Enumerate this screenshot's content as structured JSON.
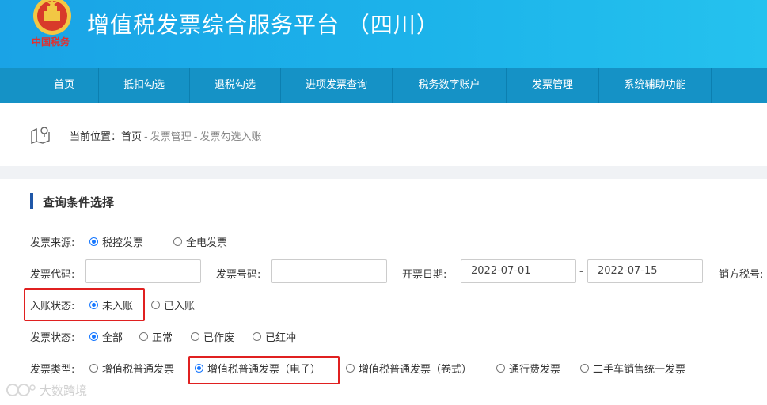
{
  "header": {
    "title": "增值税发票综合服务平台 （四川）",
    "brand": "中国税务"
  },
  "nav": {
    "items": [
      "首页",
      "抵扣勾选",
      "退税勾选",
      "进项发票查询",
      "税务数字账户",
      "发票管理",
      "系统辅助功能"
    ]
  },
  "breadcrumb": {
    "prefix": "当前位置：",
    "home": "首页",
    "sep": "-",
    "level1": "发票管理",
    "level2": "发票勾选入账"
  },
  "query": {
    "section_title": "查询条件选择",
    "source": {
      "label": "发票来源:",
      "options": [
        "税控发票",
        "全电发票"
      ],
      "selected": "税控发票"
    },
    "code": {
      "label": "发票代码:",
      "value": ""
    },
    "number": {
      "label": "发票号码:",
      "value": ""
    },
    "date": {
      "label": "开票日期:",
      "start": "2022-07-01",
      "sep": "-",
      "end": "2022-07-15"
    },
    "seller_tax_label": "销方税号:",
    "entry_status": {
      "label": "入账状态:",
      "options": [
        "未入账",
        "已入账"
      ],
      "selected": "未入账"
    },
    "invoice_status": {
      "label": "发票状态:",
      "options": [
        "全部",
        "正常",
        "已作废",
        "已红冲"
      ],
      "selected": "全部"
    },
    "invoice_type": {
      "label": "发票类型:",
      "options": [
        "增值税普通发票",
        "增值税普通发票（电子）",
        "增值税普通发票（卷式）",
        "通行费发票",
        "二手车销售统一发票"
      ],
      "selected": "增值税普通发票（电子）"
    }
  },
  "watermark": "大数跨境",
  "colors": {
    "header": "#1cb3ea",
    "nav": "#1592c6",
    "radio_accent": "#1677ff",
    "highlight": "#e02020"
  }
}
